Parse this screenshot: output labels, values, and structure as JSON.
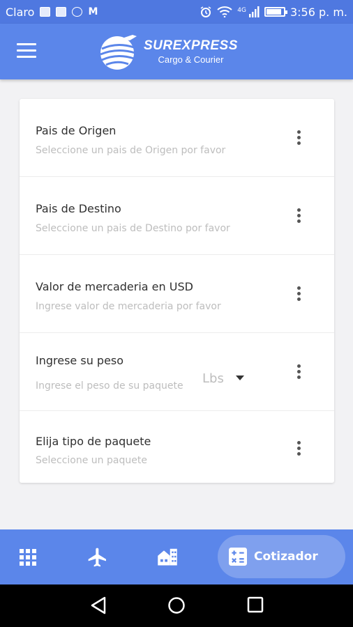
{
  "status_bar": {
    "carrier": "Claro",
    "network": "4G",
    "time": "3:56 p. m.",
    "battery_level": 0.8,
    "notification_icons": [
      "gallery-icon",
      "image-icon",
      "messenger-icon",
      "gmail-icon"
    ]
  },
  "app_bar": {
    "menu_icon": "hamburger-icon",
    "logo_title": "SUREXPRESS",
    "logo_subtitle": "Cargo & Courier"
  },
  "form": {
    "rows": [
      {
        "label": "Pais de Origen",
        "placeholder": "Seleccione un pais de Origen por favor"
      },
      {
        "label": "Pais de Destino",
        "placeholder": "Seleccione un pais de Destino por favor"
      },
      {
        "label": "Valor de mercaderia en USD",
        "placeholder": "Ingrese valor de mercaderia por favor"
      },
      {
        "label": "Ingrese su peso",
        "placeholder": "Ingrese el peso de su paquete",
        "unit": "Lbs"
      },
      {
        "label": "Elija tipo de paquete",
        "placeholder": "Seleccione un paquete"
      }
    ]
  },
  "bottom_nav": {
    "items": [
      "grid-icon",
      "airplane-icon",
      "buildings-icon"
    ],
    "active_label": "Cotizador",
    "active_icon": "calculator-icon"
  },
  "colors": {
    "primary": "#5b86ea",
    "status_bar": "#4f78e0"
  }
}
